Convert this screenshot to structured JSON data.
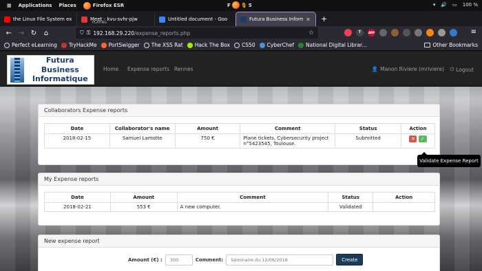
{
  "gnome": {
    "applications": "Applications",
    "places": "Places",
    "app_name": "Firefox ESR",
    "center_label_left": "F",
    "center_label_right": "5",
    "battery": "100 %"
  },
  "browser": {
    "tabs": [
      {
        "title": "the Linux File System exp",
        "favicon_color": "#ff0000"
      },
      {
        "title": "Meet - kvu-svhr-pjw",
        "subtitle": "PLAYING",
        "favicon_color": "#e53935"
      },
      {
        "title": "Untitled document - Goo",
        "favicon_color": "#4285f4"
      },
      {
        "title": "Futura Business Informati",
        "favicon_color": "#1a3c6e",
        "active": true
      }
    ],
    "url_host": "192.168.29.220",
    "url_path": "/expense_reports.php",
    "bookmarks": [
      {
        "label": "Perfect eLearning",
        "color": "#dddddd"
      },
      {
        "label": "TryHackMe",
        "color": "#c0392b"
      },
      {
        "label": "PortSwigger",
        "color": "#ff6633"
      },
      {
        "label": "The XSS Rat",
        "color": "#dddddd"
      },
      {
        "label": "Hack The Box",
        "color": "#9fef00"
      },
      {
        "label": "CS50",
        "color": "#dddddd"
      },
      {
        "label": "CyberChef",
        "color": "#4a90e2"
      },
      {
        "label": "National Digital Librar...",
        "color": "#2e7d32"
      }
    ],
    "other_bookmarks": "Other Bookmarks",
    "ext_abp": "ABP"
  },
  "site": {
    "logo_line1": "Futura Business",
    "logo_line2": "Informatique",
    "nav": {
      "home": "Home",
      "expense_reports": "Expense reports",
      "rennes": "Rennes"
    },
    "user": "Manon Riviere (mriviere)",
    "logout": "Logout"
  },
  "collab": {
    "title": "Collaborators Expense reports",
    "headers": [
      "Date",
      "Collaborator's name",
      "Amount",
      "Comment",
      "Status",
      "Action"
    ],
    "rows": [
      {
        "date": "2018-02-15",
        "name": "Samuel Lamotte",
        "amount": "750 €",
        "comment": "Plane tickets, Cybersecurity project n°5423545, Toulouse.",
        "status": "Submitted"
      }
    ]
  },
  "tooltip": "Validate Expense Report",
  "mine": {
    "title": "My Expense reports",
    "headers": [
      "Date",
      "Amount",
      "Comment",
      "Status",
      "Action"
    ],
    "rows": [
      {
        "date": "2018-02-21",
        "amount": "553 €",
        "comment": "A new computer.",
        "status": "Validated",
        "action": ""
      }
    ]
  },
  "new_report": {
    "title": "New expense report",
    "amount_label": "Amount (€) :",
    "amount_placeholder": "300",
    "comment_label": "Comment:",
    "comment_placeholder": "Séminaire du 12/06/2018",
    "submit": "Create"
  }
}
